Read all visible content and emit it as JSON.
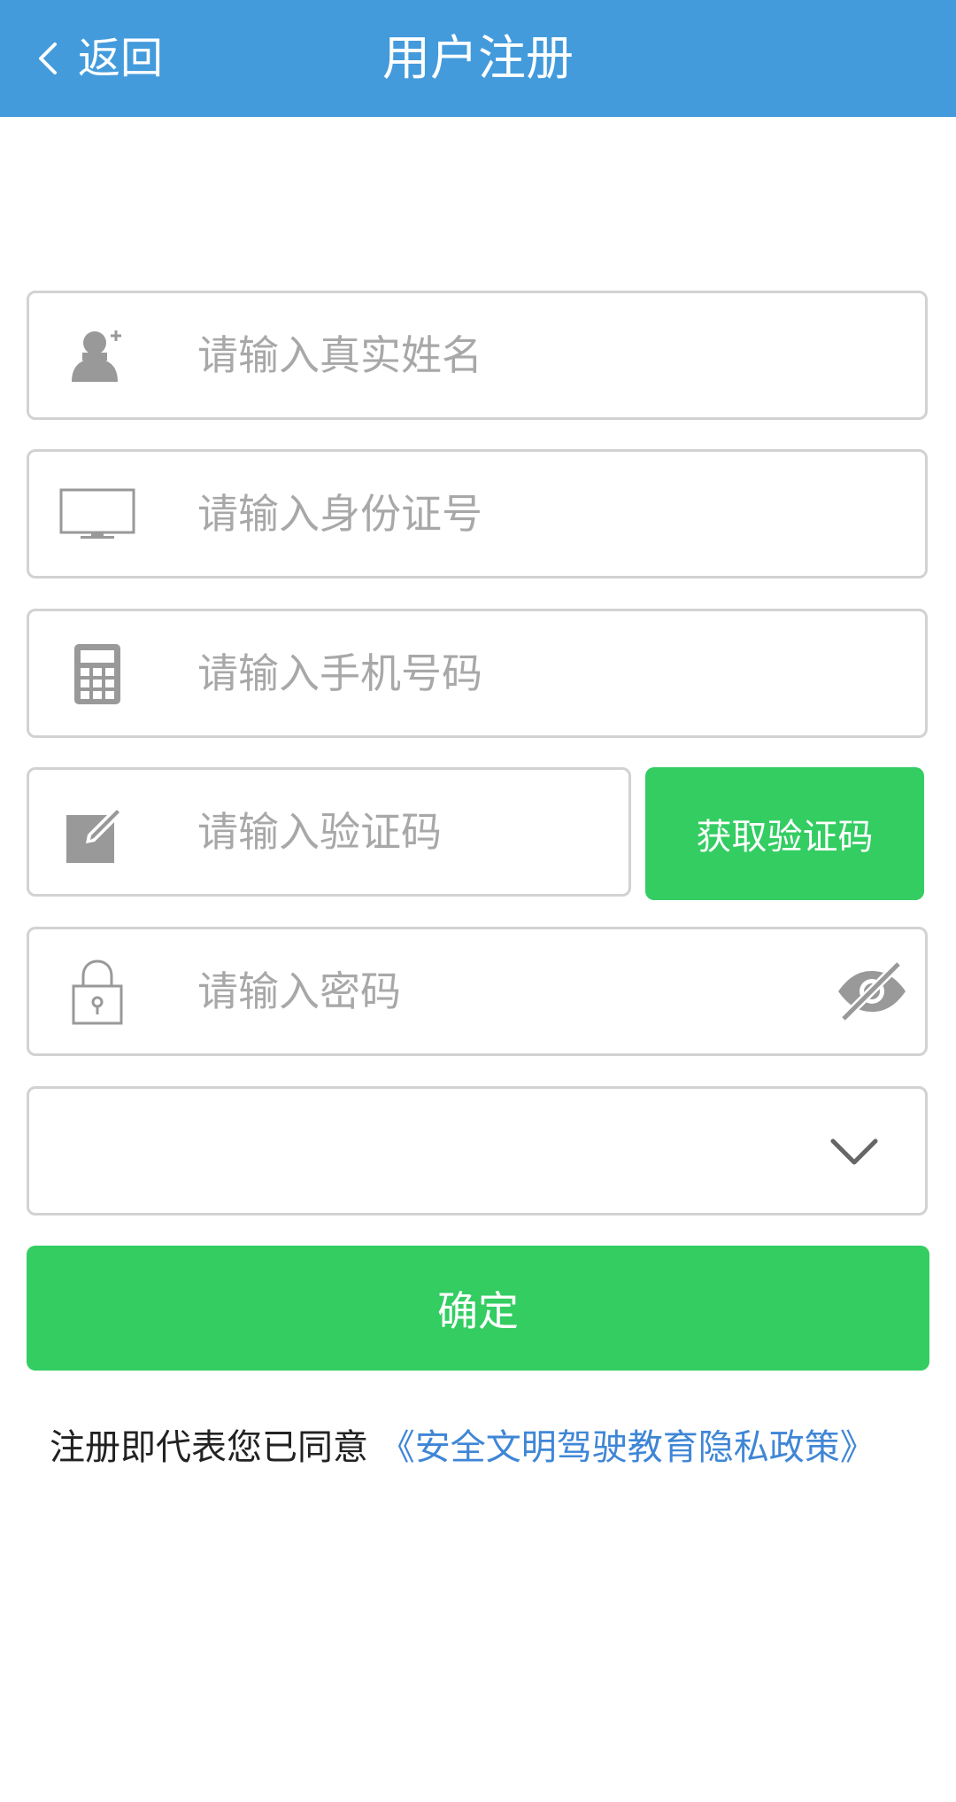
{
  "colors": {
    "header_bg": "#439bdc",
    "accent_green": "#33cd62",
    "link_blue": "#3f86d6",
    "placeholder": "#a8a8a8",
    "border": "#d2d2d2",
    "icon_gray": "#999999"
  },
  "header": {
    "back_label": "返回",
    "title": "用户注册"
  },
  "form": {
    "name": {
      "placeholder": "请输入真实姓名",
      "value": "",
      "icon": "user-add-icon"
    },
    "id_number": {
      "placeholder": "请输入身份证号",
      "value": "",
      "icon": "monitor-icon"
    },
    "phone": {
      "placeholder": "请输入手机号码",
      "value": "",
      "icon": "calculator-icon"
    },
    "code": {
      "placeholder": "请输入验证码",
      "value": "",
      "icon": "edit-icon"
    },
    "get_code_label": "获取验证码",
    "password": {
      "placeholder": "请输入密码",
      "value": "",
      "icon": "lock-icon",
      "toggle_icon": "eye-hidden-icon"
    },
    "select": {
      "value": "",
      "icon": "chevron-down-icon"
    }
  },
  "confirm_label": "确定",
  "agreement": {
    "text": "注册即代表您已同意",
    "link": "《安全文明驾驶教育隐私政策》"
  }
}
